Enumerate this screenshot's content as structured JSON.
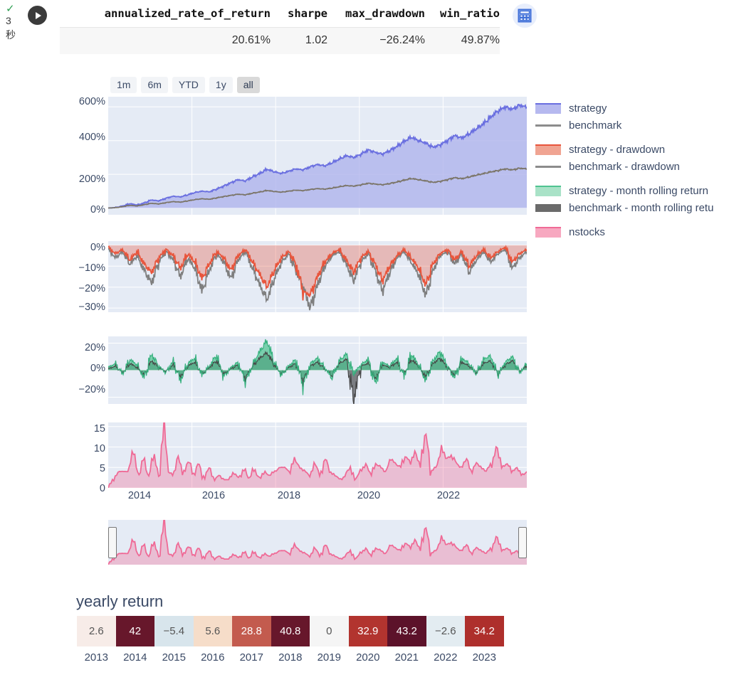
{
  "cell": {
    "status_icon": "check-icon",
    "runtime_value": "3",
    "runtime_unit": "秒",
    "run_icon": "play-icon",
    "table_view_icon": "table-icon"
  },
  "metrics": {
    "headers": [
      "annualized_rate_of_return",
      "sharpe",
      "max_drawdown",
      "win_ratio"
    ],
    "values": [
      "20.61%",
      "1.02",
      "−26.24%",
      "49.87%"
    ]
  },
  "range_selector": {
    "buttons": [
      "1m",
      "6m",
      "YTD",
      "1y",
      "all"
    ],
    "active": "all"
  },
  "legend": {
    "items": [
      {
        "label": "strategy",
        "color": "#6a6fe0",
        "swatch": "area"
      },
      {
        "label": "benchmark",
        "color": "#8c8c8c",
        "swatch": "line"
      },
      {
        "label": "strategy - drawdown",
        "color": "#e8553c",
        "swatch": "area"
      },
      {
        "label": "benchmark - drawdown",
        "color": "#8c8c8c",
        "swatch": "line"
      },
      {
        "label": "strategy - month rolling return",
        "color": "#4fc391",
        "swatch": "area"
      },
      {
        "label": "benchmark - month rolling retu",
        "color": "#6b6b6b",
        "swatch": "bar"
      },
      {
        "label": "nstocks",
        "color": "#f06a96",
        "swatch": "area"
      }
    ]
  },
  "axes": {
    "equity_y": [
      "600%",
      "400%",
      "200%",
      "0%"
    ],
    "drawdown_y": [
      "0%",
      "−10%",
      "−20%",
      "−30%"
    ],
    "rolling_y": [
      "20%",
      "0%",
      "−20%"
    ],
    "nstocks_y": [
      "15",
      "10",
      "5",
      "0"
    ],
    "x_ticks": [
      "2014",
      "2016",
      "2018",
      "2020",
      "2022"
    ]
  },
  "yearly_return": {
    "title": "yearly return",
    "years": [
      "2013",
      "2014",
      "2015",
      "2016",
      "2017",
      "2018",
      "2019",
      "2020",
      "2021",
      "2022",
      "2023"
    ],
    "values": [
      "2.6",
      "42",
      "−5.4",
      "5.6",
      "28.8",
      "40.8",
      "0",
      "32.9",
      "43.2",
      "−2.6",
      "34.2"
    ],
    "cell_colors": [
      "#f7ece8",
      "#67172b",
      "#d8e5ec",
      "#f6ddc9",
      "#c35b4e",
      "#67172b",
      "#f5f5f5",
      "#b2342f",
      "#5c122a",
      "#e3ecf1",
      "#ae2f2c"
    ],
    "text_colors": [
      "#555555",
      "#ffffff",
      "#555555",
      "#555555",
      "#ffffff",
      "#ffffff",
      "#555555",
      "#ffffff",
      "#ffffff",
      "#555555",
      "#ffffff"
    ]
  },
  "chart_data": [
    {
      "type": "area",
      "title": "cumulative return",
      "ylabel": "",
      "xlabel": "",
      "ylim": [
        -40,
        660
      ],
      "yticks": [
        0,
        200,
        400,
        600
      ],
      "x": [
        "2013",
        "2014",
        "2015",
        "2016",
        "2017",
        "2018",
        "2019",
        "2020",
        "2021",
        "2022",
        "2023"
      ],
      "grid": true,
      "series": [
        {
          "name": "strategy",
          "color": "#6a6fe0",
          "values": [
            0,
            3,
            12,
            26,
            18,
            30,
            48,
            42,
            58,
            70,
            66,
            78,
            92,
            100,
            96,
            112,
            130,
            150,
            168,
            160,
            185,
            205,
            230,
            215,
            205,
            218,
            232,
            226,
            245,
            258,
            250,
            268,
            290,
            310,
            300,
            318,
            345,
            330,
            320,
            340,
            365,
            395,
            420,
            400,
            385,
            360,
            375,
            400,
            430,
            415,
            440,
            470,
            500,
            540,
            575,
            600,
            585,
            610,
            598
          ]
        },
        {
          "name": "benchmark",
          "color": "#7a7466",
          "values": [
            0,
            2,
            8,
            16,
            12,
            20,
            28,
            24,
            32,
            38,
            35,
            42,
            50,
            55,
            52,
            60,
            68,
            75,
            82,
            78,
            88,
            95,
            104,
            98,
            94,
            100,
            106,
            103,
            110,
            115,
            112,
            118,
            126,
            133,
            130,
            137,
            147,
            142,
            138,
            145,
            154,
            165,
            175,
            168,
            161,
            152,
            158,
            168,
            180,
            174,
            184,
            195,
            204,
            214,
            222,
            232,
            226,
            236,
            232
          ]
        }
      ]
    },
    {
      "type": "area",
      "title": "drawdown",
      "ylim": [
        -32,
        2
      ],
      "yticks": [
        0,
        -10,
        -20,
        -30
      ],
      "grid": true,
      "series": [
        {
          "name": "strategy - drawdown",
          "color": "#e8553c",
          "values": [
            -1,
            -4,
            -2,
            -7,
            -3,
            -9,
            -13,
            -6,
            -2,
            -5,
            -11,
            -4,
            -8,
            -16,
            -9,
            -3,
            -6,
            -12,
            -5,
            -2,
            -8,
            -14,
            -20,
            -12,
            -6,
            -3,
            -9,
            -22,
            -24,
            -15,
            -8,
            -4,
            -2,
            -7,
            -13,
            -6,
            -3,
            -9,
            -17,
            -10,
            -5,
            -2,
            -6,
            -11,
            -19,
            -9,
            -4,
            -2,
            -7,
            -3,
            -10,
            -5,
            -2,
            -6,
            -3,
            -1,
            -8,
            -4,
            -2
          ]
        },
        {
          "name": "benchmark - drawdown",
          "color": "#7f7f7f",
          "values": [
            -2,
            -6,
            -3,
            -9,
            -5,
            -12,
            -18,
            -8,
            -3,
            -7,
            -15,
            -6,
            -11,
            -22,
            -12,
            -4,
            -8,
            -16,
            -7,
            -3,
            -11,
            -19,
            -26,
            -16,
            -8,
            -4,
            -12,
            -20,
            -30,
            -19,
            -10,
            -5,
            -3,
            -9,
            -17,
            -8,
            -4,
            -12,
            -22,
            -13,
            -6,
            -3,
            -8,
            -14,
            -24,
            -12,
            -5,
            -3,
            -9,
            -4,
            -13,
            -7,
            -3,
            -8,
            -4,
            -2,
            -11,
            -6,
            -3
          ]
        }
      ]
    },
    {
      "type": "area",
      "title": "month rolling return",
      "ylim": [
        -25,
        25
      ],
      "yticks": [
        20,
        0,
        -20
      ],
      "grid": true,
      "series": [
        {
          "name": "strategy - month rolling return",
          "color": "#4fc391",
          "values": [
            2,
            5,
            -3,
            8,
            4,
            -6,
            12,
            3,
            -2,
            7,
            -8,
            5,
            9,
            -4,
            3,
            11,
            -5,
            2,
            6,
            -9,
            4,
            14,
            22,
            6,
            -4,
            3,
            8,
            -12,
            5,
            9,
            2,
            -6,
            7,
            12,
            -3,
            4,
            8,
            -10,
            6,
            3,
            9,
            -5,
            12,
            4,
            -8,
            7,
            14,
            3,
            -6,
            9,
            5,
            -3,
            8,
            11,
            -4,
            6,
            10,
            -2,
            5
          ]
        },
        {
          "name": "benchmark - month rolling return",
          "color": "#555555",
          "values": [
            1,
            3,
            -2,
            5,
            2,
            -4,
            7,
            2,
            -1,
            4,
            -5,
            3,
            6,
            -3,
            2,
            7,
            -3,
            1,
            4,
            -6,
            3,
            9,
            13,
            4,
            -3,
            2,
            5,
            -8,
            3,
            6,
            1,
            -4,
            5,
            8,
            -22,
            3,
            5,
            -7,
            4,
            2,
            6,
            -3,
            8,
            3,
            -5,
            5,
            9,
            2,
            -4,
            6,
            3,
            -2,
            5,
            7,
            -3,
            4,
            7,
            -1,
            3
          ]
        }
      ]
    },
    {
      "type": "area",
      "title": "nstocks",
      "ylim": [
        0,
        16
      ],
      "yticks": [
        0,
        5,
        10,
        15
      ],
      "xticks": [
        "2014",
        "2016",
        "2018",
        "2020",
        "2022"
      ],
      "grid": true,
      "series": [
        {
          "name": "nstocks",
          "color": "#f06a96",
          "values": [
            0,
            2,
            4,
            4,
            4,
            9,
            3,
            7,
            3,
            8,
            3,
            15,
            4,
            3,
            8,
            3,
            7,
            3,
            6,
            2,
            5,
            2,
            3,
            2,
            2,
            4,
            2,
            5,
            2,
            5,
            2,
            4,
            3,
            4,
            5,
            5,
            4,
            7,
            5,
            4,
            3,
            6,
            3,
            7,
            4,
            3,
            2,
            3,
            5,
            2,
            4,
            6,
            3,
            6,
            5,
            4,
            7,
            6,
            5,
            8,
            6,
            9,
            5,
            14,
            4,
            5,
            10,
            7,
            8,
            6,
            5,
            7,
            4,
            6,
            5,
            4,
            6,
            10,
            5,
            6,
            4,
            5,
            3,
            4
          ]
        }
      ]
    }
  ]
}
